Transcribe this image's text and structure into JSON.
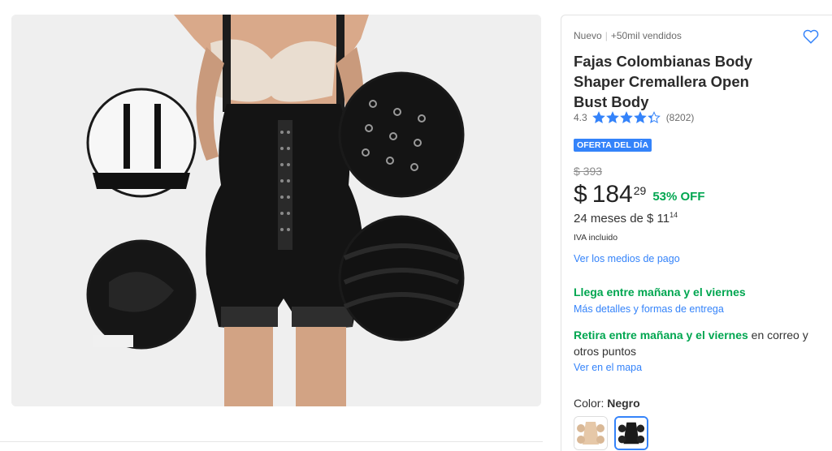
{
  "product": {
    "condition": "Nuevo",
    "sold": "+50mil vendidos",
    "title": "Fajas Colombianas Body Shaper Cremallera Open Bust Body",
    "rating": {
      "score": "4.3",
      "reviews": "(8202)",
      "stars_value": 4.3,
      "max_stars": 5
    },
    "badge": "OFERTA DEL DÍA",
    "old_price": "$ 393",
    "price": {
      "currency": "$",
      "amount": "184",
      "cents": "29"
    },
    "discount": "53% OFF",
    "installments": {
      "text": "24 meses de $ 11",
      "cents": "14"
    },
    "tax": "IVA incluido",
    "payment_link": "Ver los medios de pago",
    "delivery": {
      "title": "Llega entre mañana y el viernes",
      "link": "Más detalles y formas de entrega"
    },
    "pickup": {
      "highlight": "Retira entre mañana y el viernes",
      "rest": " en correo y otros puntos",
      "link": "Ver en el mapa"
    },
    "color": {
      "label": "Color: ",
      "value": "Negro"
    },
    "swatches": [
      {
        "name": "Beige",
        "selected": false
      },
      {
        "name": "Negro",
        "selected": true
      }
    ]
  },
  "icons": {
    "favorite": "heart-outline-icon",
    "star": "star-icon"
  },
  "colors": {
    "accent": "#3483fa",
    "green": "#00a650",
    "star": "#3483fa"
  }
}
